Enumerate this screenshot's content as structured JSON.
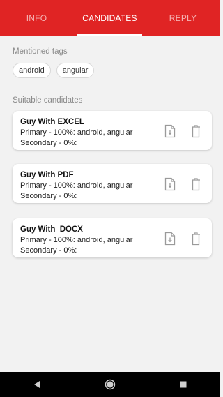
{
  "tabs": [
    {
      "label": "INFO",
      "active": false
    },
    {
      "label": "CANDIDATES",
      "active": true
    },
    {
      "label": "REPLY",
      "active": false
    }
  ],
  "mentioned_tags": {
    "label": "Mentioned tags",
    "items": [
      "android",
      "angular"
    ]
  },
  "suitable_candidates": {
    "label": "Suitable candidates",
    "items": [
      {
        "name": "Guy With EXCEL",
        "primary": "Primary - 100%: android, angular",
        "secondary": "Secondary - 0%:"
      },
      {
        "name": "Guy With PDF",
        "primary": "Primary - 100%: android, angular",
        "secondary": "Secondary - 0%:"
      },
      {
        "name": "Guy With  DOCX",
        "primary": "Primary - 100%: android, angular",
        "secondary": "Secondary - 0%:"
      }
    ]
  },
  "icons": {
    "download": "file-download-icon",
    "delete": "trash-icon",
    "nav_back": "back-triangle-icon",
    "nav_home": "home-circle-icon",
    "nav_recents": "recents-square-icon"
  },
  "colors": {
    "tab_bar": "#e02424",
    "background": "#f2f2f2",
    "card": "#ffffff",
    "nav_bar": "#000000"
  }
}
